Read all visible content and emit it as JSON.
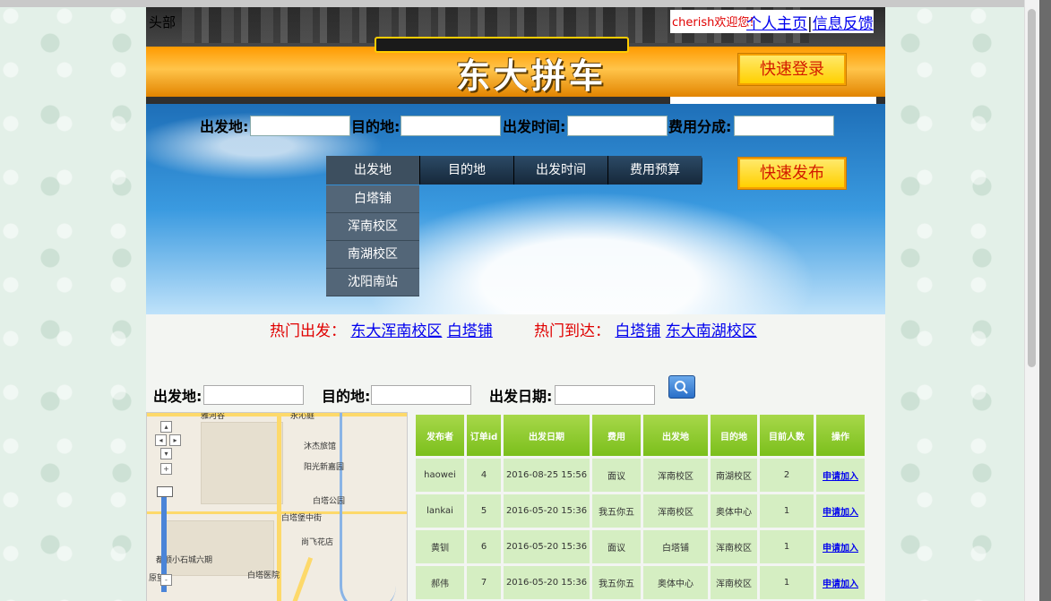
{
  "header": {
    "label": "头部",
    "title": "东大拼车",
    "welcome": "cherish欢迎您!",
    "links": [
      "个人主页",
      "|",
      "信息反馈"
    ],
    "login_button": "快速登录"
  },
  "search": {
    "fields": [
      "出发地:",
      "目的地:",
      "出发时间:",
      "费用分成:"
    ],
    "tabs": [
      "出发地",
      "目的地",
      "出发时间",
      "费用预算"
    ],
    "dropdown": [
      "白塔铺",
      "浑南校区",
      "南湖校区",
      "沈阳南站"
    ],
    "publish_button": "快速发布"
  },
  "hot": {
    "depart_label": "热门出发：",
    "depart_links": [
      "东大浑南校区",
      "白塔铺"
    ],
    "arrive_label": "热门到达：",
    "arrive_links": [
      "白塔铺",
      "东大南湖校区"
    ]
  },
  "filter": {
    "labels": [
      "出发地:",
      "目的地:",
      "出发日期:"
    ],
    "search_icon": "magnifier-icon"
  },
  "map": {
    "pois": [
      "雅河谷",
      "永沁庭",
      "沐杰旅馆",
      "阳光新嘉园",
      "白塔公园",
      "白塔堡中街",
      "尚飞花店",
      "都顺小石城六期",
      "白塔医院",
      "原望"
    ],
    "controls": [
      "+",
      "-"
    ]
  },
  "table": {
    "headers": [
      "发布者",
      "订单id",
      "出发日期",
      "费用",
      "出发地",
      "目的地",
      "目前人数",
      "操作"
    ],
    "rows": [
      [
        "haowei",
        "4",
        "2016-08-25 15:56",
        "面议",
        "浑南校区",
        "南湖校区",
        "2",
        "申请加入"
      ],
      [
        "lankai",
        "5",
        "2016-05-20 15:36",
        "我五你五",
        "浑南校区",
        "奥体中心",
        "1",
        "申请加入"
      ],
      [
        "黄钏",
        "6",
        "2016-05-20 15:36",
        "面议",
        "白塔铺",
        "浑南校区",
        "1",
        "申请加入"
      ],
      [
        "郝伟",
        "7",
        "2016-05-20 15:36",
        "我五你五",
        "奥体中心",
        "浑南校区",
        "1",
        "申请加入"
      ]
    ]
  },
  "colors": {
    "header_band": "#ff9a00",
    "table_header": "#8cc63f",
    "table_cell": "#d5eec2",
    "link": "#0000ee",
    "hot_label": "#e00000"
  }
}
